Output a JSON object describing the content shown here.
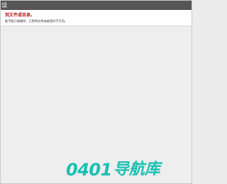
{
  "window": {
    "title": "误"
  },
  "error": {
    "heading": "到文件或目录。",
    "description": "能不能已被删除，已更改名称或者暂时不可用。"
  },
  "watermark": {
    "digits": "0401",
    "text": "导航库",
    "color": "#19c0b2"
  },
  "colors": {
    "header_bg": "#555555",
    "error_heading": "#b21f1f",
    "page_bg": "#eeeeee"
  }
}
